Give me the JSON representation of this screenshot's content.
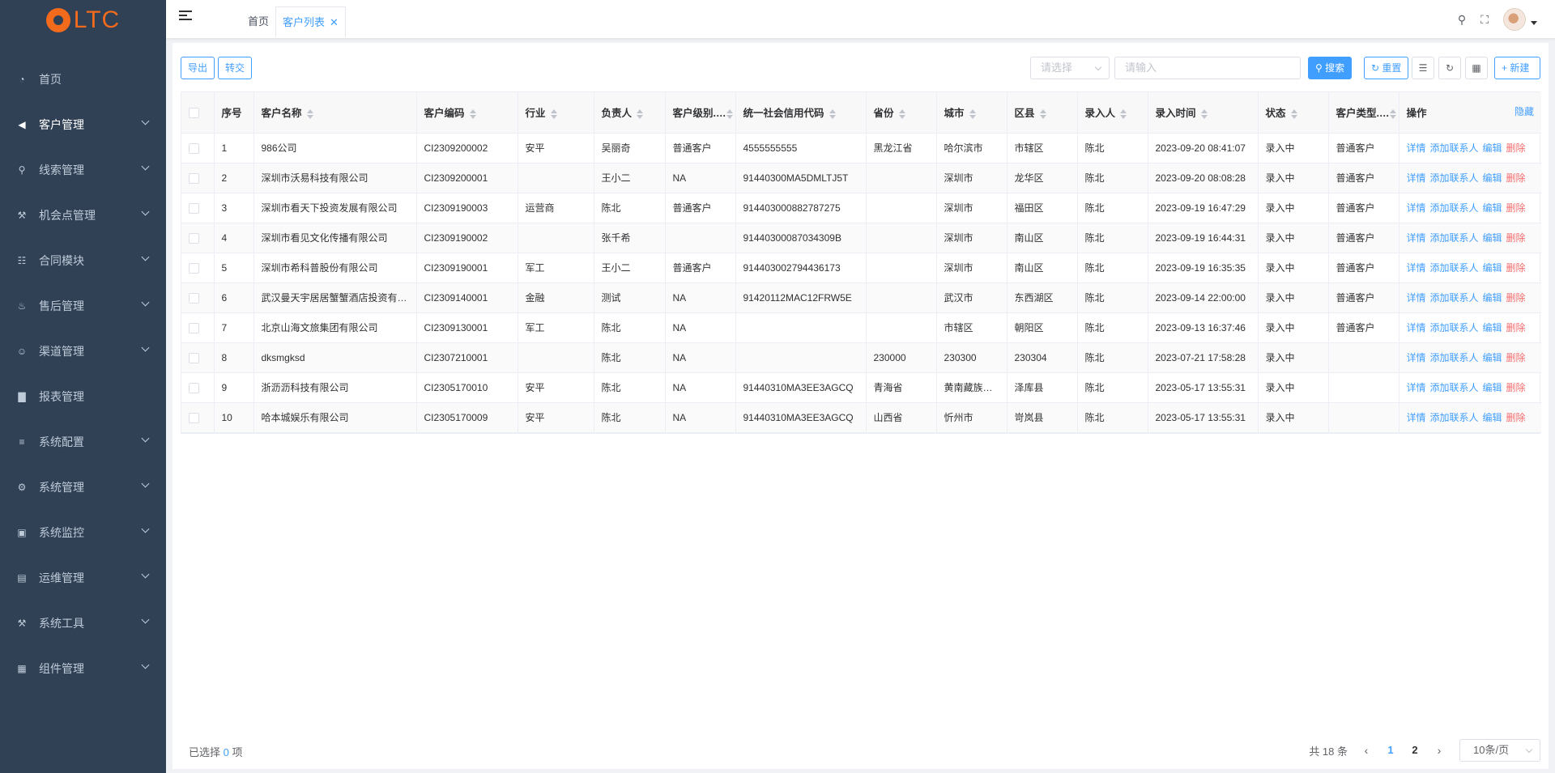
{
  "brand": {
    "logo_text": "LTC",
    "logo_color": "#f26b1d"
  },
  "sidebar": {
    "items": [
      {
        "label": "首页",
        "icon": "dashboard-icon",
        "has_children": false
      },
      {
        "label": "客户管理",
        "icon": "megaphone-icon",
        "has_children": true
      },
      {
        "label": "线索管理",
        "icon": "search-icon",
        "has_children": true
      },
      {
        "label": "机会点管理",
        "icon": "tools-icon",
        "has_children": true
      },
      {
        "label": "合同模块",
        "icon": "contract-icon",
        "has_children": true
      },
      {
        "label": "售后管理",
        "icon": "service-icon",
        "has_children": true
      },
      {
        "label": "渠道管理",
        "icon": "users-icon",
        "has_children": true
      },
      {
        "label": "报表管理",
        "icon": "chart-icon",
        "has_children": false
      },
      {
        "label": "系统配置",
        "icon": "config-icon",
        "has_children": true
      },
      {
        "label": "系统管理",
        "icon": "gear-icon",
        "has_children": true
      },
      {
        "label": "系统监控",
        "icon": "monitor-icon",
        "has_children": true
      },
      {
        "label": "运维管理",
        "icon": "server-icon",
        "has_children": true
      },
      {
        "label": "系统工具",
        "icon": "wrench-icon",
        "has_children": true
      },
      {
        "label": "组件管理",
        "icon": "grid-icon",
        "has_children": true
      }
    ]
  },
  "tabs": [
    {
      "label": "首页",
      "active": false
    },
    {
      "label": "客户列表",
      "active": true
    }
  ],
  "toolbar": {
    "export_label": "导出",
    "transfer_label": "转交",
    "select_placeholder": "请选择",
    "search_placeholder": "请输入",
    "search_label": "搜索",
    "reset_label": "重置",
    "new_label": "新建"
  },
  "table": {
    "headers": [
      "序号",
      "客户名称",
      "客户编码",
      "行业",
      "负责人",
      "客户级别...",
      "统一社会信用代码",
      "省份",
      "城市",
      "区县",
      "录入人",
      "录入时间",
      "状态",
      "客户类型...",
      "操作"
    ],
    "hide_label": "隐藏",
    "ops": {
      "detail": "详情",
      "add_contact": "添加联系人",
      "edit": "编辑",
      "delete": "删除"
    },
    "rows": [
      [
        "1",
        "986公司",
        "CI2309200002",
        "安平",
        "吴丽奇",
        "普通客户",
        "4555555555",
        "黑龙江省",
        "哈尔滨市",
        "市辖区",
        "陈北",
        "2023-09-20 08:41:07",
        "录入中",
        "普通客户"
      ],
      [
        "2",
        "深圳市沃易科技有限公司",
        "CI2309200001",
        "",
        "王小二",
        "NA",
        "91440300MA5DMLTJ5T",
        "",
        "深圳市",
        "龙华区",
        "陈北",
        "2023-09-20 08:08:28",
        "录入中",
        "普通客户"
      ],
      [
        "3",
        "深圳市看天下投资发展有限公司",
        "CI2309190003",
        "运营商",
        "陈北",
        "普通客户",
        "914403000882787275",
        "",
        "深圳市",
        "福田区",
        "陈北",
        "2023-09-19 16:47:29",
        "录入中",
        "普通客户"
      ],
      [
        "4",
        "深圳市看见文化传播有限公司",
        "CI2309190002",
        "",
        "张千希",
        "",
        "91440300087034309B",
        "",
        "深圳市",
        "南山区",
        "陈北",
        "2023-09-19 16:44:31",
        "录入中",
        "普通客户"
      ],
      [
        "5",
        "深圳市希科普股份有限公司",
        "CI2309190001",
        "军工",
        "王小二",
        "普通客户",
        "914403002794436173",
        "",
        "深圳市",
        "南山区",
        "陈北",
        "2023-09-19 16:35:35",
        "录入中",
        "普通客户"
      ],
      [
        "6",
        "武汉曼天宇居居蟹蟹酒店投资有限公司",
        "CI2309140001",
        "金融",
        "测试",
        "NA",
        "91420112MAC12FRW5E",
        "",
        "武汉市",
        "东西湖区",
        "陈北",
        "2023-09-14 22:00:00",
        "录入中",
        "普通客户"
      ],
      [
        "7",
        "北京山海文旅集团有限公司",
        "CI2309130001",
        "军工",
        "陈北",
        "NA",
        "",
        "",
        "市辖区",
        "朝阳区",
        "陈北",
        "2023-09-13 16:37:46",
        "录入中",
        "普通客户"
      ],
      [
        "8",
        "dksmgksd",
        "CI2307210001",
        "",
        "陈北",
        "NA",
        "",
        "230000",
        "230300",
        "230304",
        "陈北",
        "2023-07-21 17:58:28",
        "录入中",
        ""
      ],
      [
        "9",
        "浙沥沥科技有限公司",
        "CI2305170010",
        "安平",
        "陈北",
        "NA",
        "91440310MA3EE3AGCQ",
        "青海省",
        "黄南藏族自治州",
        "泽库县",
        "陈北",
        "2023-05-17 13:55:31",
        "录入中",
        ""
      ],
      [
        "10",
        "哈本城娱乐有限公司",
        "CI2305170009",
        "安平",
        "陈北",
        "NA",
        "91440310MA3EE3AGCQ",
        "山西省",
        "忻州市",
        "岢岚县",
        "陈北",
        "2023-05-17 13:55:31",
        "录入中",
        ""
      ]
    ]
  },
  "footer": {
    "selected_prefix": "已选择",
    "selected_count": "0",
    "selected_suffix": "项",
    "total_label": "共 18 条",
    "page_1": "1",
    "page_2": "2",
    "page_size": "10条/页"
  },
  "colors": {
    "sidebar_bg": "#304156",
    "primary": "#409eff",
    "danger": "#f56c6c"
  }
}
